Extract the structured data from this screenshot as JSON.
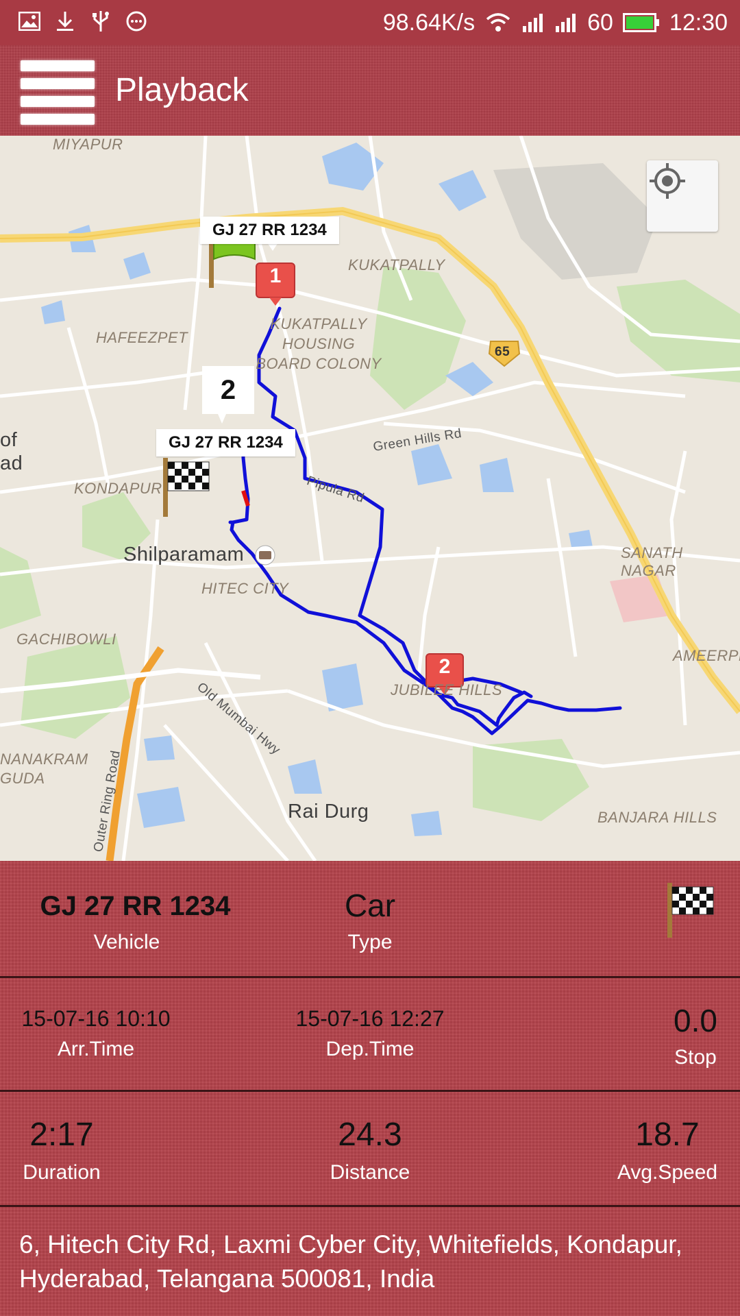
{
  "status_bar": {
    "speed": "98.64K/s",
    "signal_text": "60",
    "time": "12:30",
    "icons": [
      "image-icon",
      "download-icon",
      "usb-icon",
      "more-icon",
      "wifi-icon",
      "signal-icon",
      "signal-icon",
      "battery-icon"
    ]
  },
  "app_bar": {
    "title": "Playback"
  },
  "map": {
    "area_labels": {
      "miyapur": "MIYAPUR",
      "kukatpally": "KUKATPALLY",
      "kphb": "KUKATPALLY HOUSING BOARD COLONY",
      "hafeezpet": "HAFEEZPET",
      "kondapur": "KONDAPUR",
      "hitec_city": "HITEC CITY",
      "gachibowli": "GACHIBOWLI",
      "jubilee_hills": "JUBILEE HILLS",
      "sanath_nagar": "SANATH NAGAR",
      "ameerpet": "AMEERPE",
      "nanakram_guda": "NANAKRAM GUDA",
      "banjara_hills": "BANJARA HILLS",
      "edge_text_1": "of",
      "edge_text_2": "ad"
    },
    "place_labels": {
      "shilparamam": "Shilparamam",
      "rai_durg": "Rai Durg"
    },
    "road_labels": {
      "green_hills": "Green Hills Rd",
      "pipula": "Pipula Rd",
      "old_mumbai": "Old Mumbai Hwy",
      "outer_ring": "Outer Ring Road",
      "highway_shield": "65"
    },
    "markers": {
      "start_label": "GJ 27 RR 1234",
      "end_label": "GJ 27 RR 1234",
      "pin_1": "1",
      "pin_2": "2",
      "info_number": "2"
    },
    "route_color": "#1010d8",
    "overspeed_color": "#e01010"
  },
  "summary": {
    "vehicle_value": "GJ 27 RR 1234",
    "vehicle_label": "Vehicle",
    "type_value": "Car",
    "type_label": "Type",
    "arr_time_value": "15-07-16 10:10",
    "arr_time_label": "Arr.Time",
    "dep_time_value": "15-07-16 12:27",
    "dep_time_label": "Dep.Time",
    "stop_value": "0.0",
    "stop_label": "Stop",
    "duration_value": "2:17",
    "duration_label": "Duration",
    "distance_value": "24.3",
    "distance_label": "Distance",
    "avg_speed_value": "18.7",
    "avg_speed_label": "Avg.Speed",
    "address": "6, Hitech City Rd, Laxmi Cyber City, Whitefields, Kondapur, Hyderabad, Telangana 500081, India"
  },
  "colors": {
    "panel": "#b4434c",
    "status_bar": "#a83a44"
  }
}
